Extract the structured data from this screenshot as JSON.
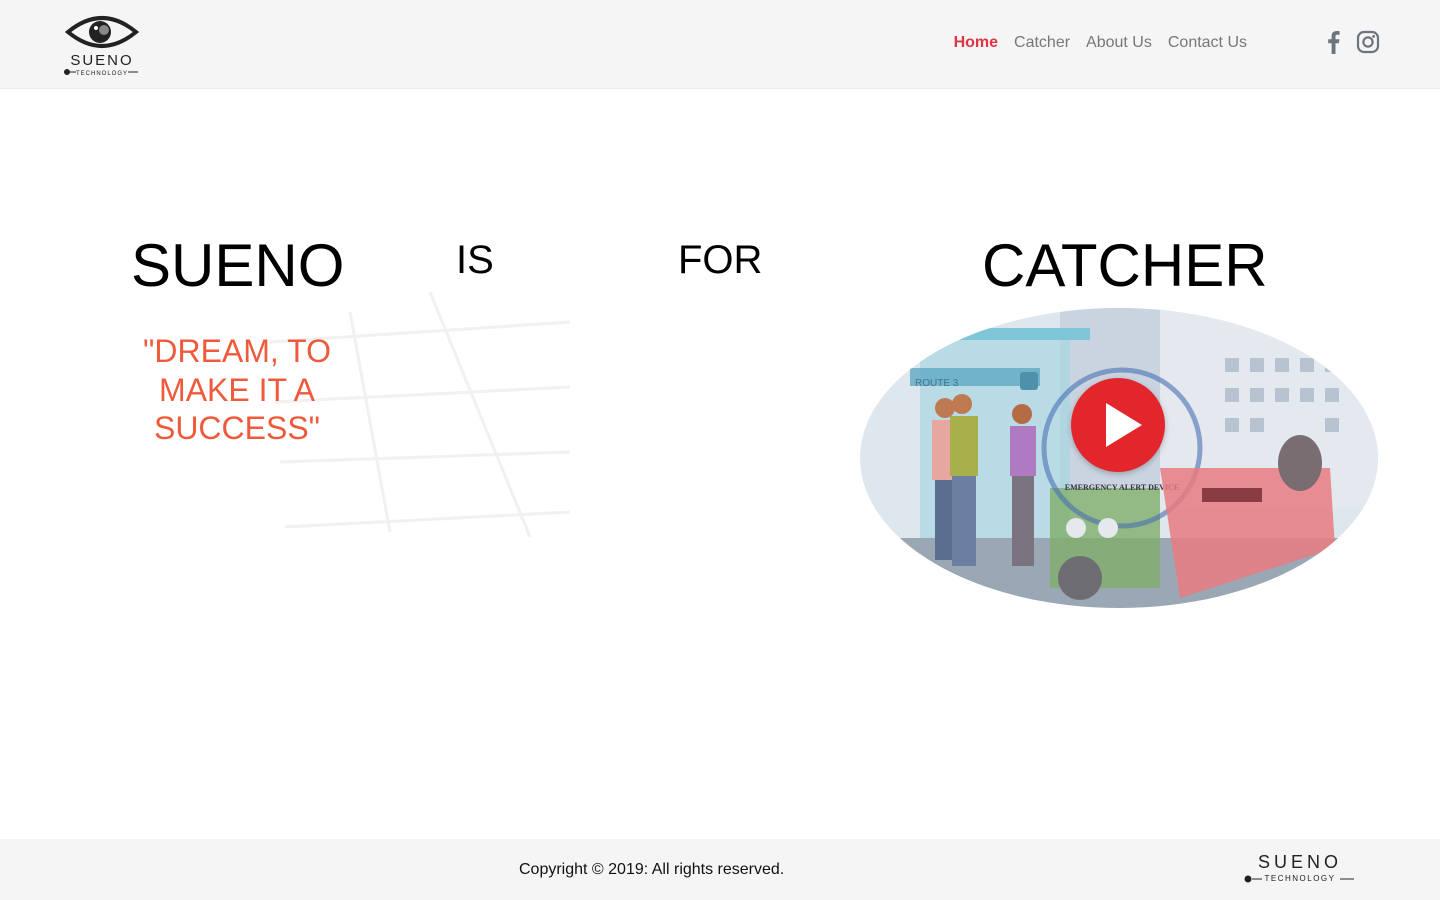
{
  "header": {
    "logo": {
      "icon": "sueno-eye-logo-icon",
      "text": "SUENO",
      "subtext": "TECHNOLOGY"
    },
    "nav": [
      {
        "label": "Home",
        "active": true
      },
      {
        "label": "Catcher",
        "active": false
      },
      {
        "label": "About Us",
        "active": false
      },
      {
        "label": "Contact Us",
        "active": false
      }
    ],
    "social": [
      {
        "icon": "facebook-icon"
      },
      {
        "icon": "instagram-icon"
      }
    ]
  },
  "hero": {
    "words": [
      "SUENO",
      "IS",
      "FOR",
      "CATCHER"
    ],
    "tagline": "\"DREAM, TO MAKE IT A SUCCESS\"",
    "video": {
      "thumbnail_labels": [
        "ROUTE 3",
        "EMERGENCY ALERT DEVICE"
      ],
      "play_icon": "play-icon"
    }
  },
  "footer": {
    "copyright": "Copyright © 2019: All rights reserved.",
    "logo": {
      "text": "SUENO",
      "subtext": "TECHNOLOGY"
    }
  },
  "colors": {
    "accent": "#dc3545",
    "tagline": "#ef5a3c",
    "play": "#e3262b",
    "bar_bg": "#f5f5f5"
  }
}
